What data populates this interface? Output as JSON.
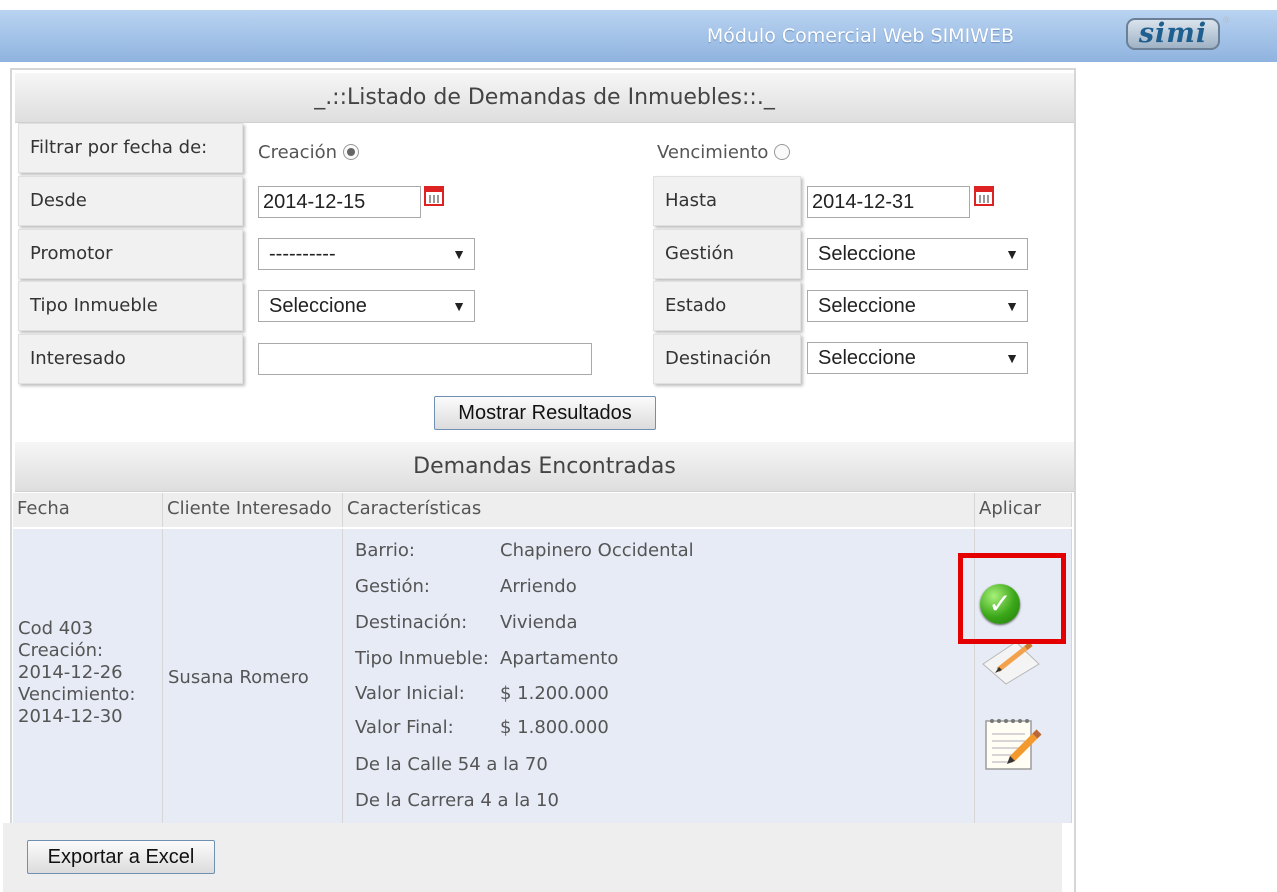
{
  "header": {
    "title": "Módulo Comercial Web SIMIWEB",
    "logo_text": "simi",
    "logo_mark": "®"
  },
  "list_title": "_.::Listado de Demandas de Inmuebles::._",
  "filter": {
    "date_filter_label": "Filtrar por fecha de:",
    "creation_label": "Creación",
    "creation_checked": true,
    "expiry_label": "Vencimiento",
    "expiry_checked": false,
    "from_label": "Desde",
    "from_value": "2014-12-15",
    "to_label": "Hasta",
    "to_value": "2014-12-31",
    "promoter_label": "Promotor",
    "promoter_value": "----------",
    "management_label": "Gestión",
    "management_value": "Seleccione",
    "property_type_label": "Tipo Inmueble",
    "property_type_value": "Seleccione",
    "status_label": "Estado",
    "status_value": "Seleccione",
    "interested_label": "Interesado",
    "interested_value": "",
    "destination_label": "Destinación",
    "destination_value": "Seleccione",
    "show_results_label": "Mostrar Resultados"
  },
  "results": {
    "title": "Demandas Encontradas",
    "columns": [
      "Fecha",
      "Cliente Interesado",
      "Características",
      "Aplicar"
    ],
    "row": {
      "code": "Cod 403",
      "created_label": "Creación:",
      "created_value": "2014-12-26",
      "expiry_label": "Vencimiento:",
      "expiry_value": "2014-12-30",
      "client": "Susana Romero",
      "characteristics": [
        {
          "label": "Barrio:",
          "value": "Chapinero Occidental"
        },
        {
          "label": "Gestión:",
          "value": "Arriendo"
        },
        {
          "label": "Destinación:",
          "value": "Vivienda"
        },
        {
          "label": "Tipo Inmueble:",
          "value": "Apartamento"
        },
        {
          "label": "Valor Inicial:",
          "value": "$ 1.200.000"
        },
        {
          "label": "Valor Final:",
          "value": "$ 1.800.000"
        }
      ],
      "street_range": "De la Calle 54 a la 70",
      "carrera_range": "De la Carrera 4 a la 10",
      "apply_icons": [
        "check-icon",
        "pencil-icon",
        "notepad-icon"
      ]
    }
  },
  "export_label": "Exportar a Excel",
  "colors": {
    "header_blue": "#8fb3df",
    "row_bg": "#e6ebf6",
    "highlight_red": "#e40000",
    "calendar_red": "#dd2222"
  }
}
